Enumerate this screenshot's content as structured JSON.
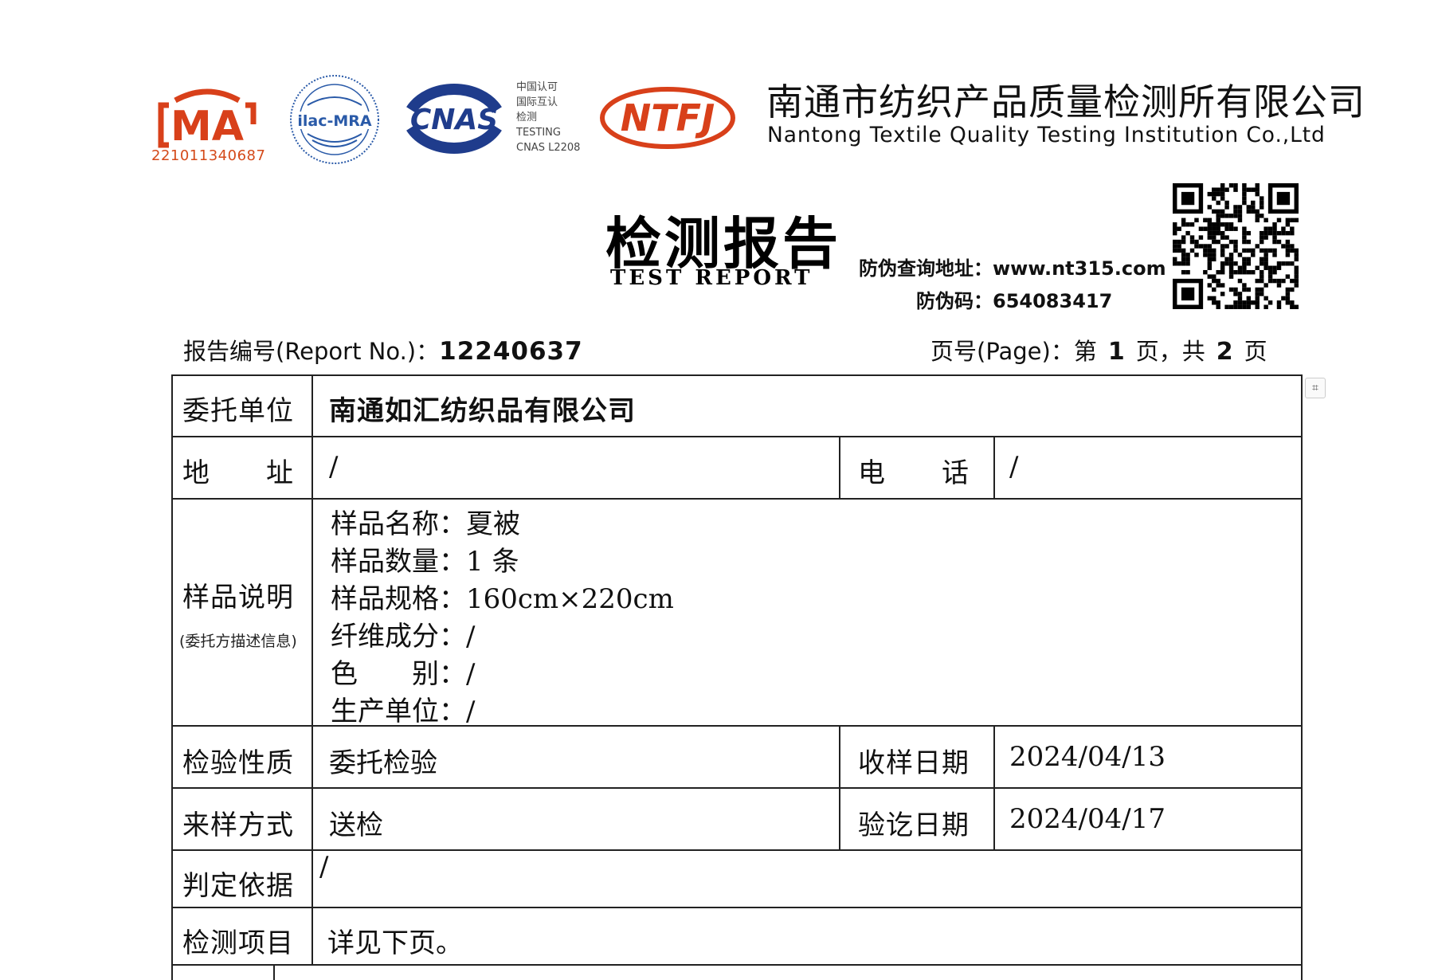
{
  "header": {
    "cma_number": "221011340687",
    "cma_logo_text": "MA",
    "ilac_logo_text": "ilac-MRA",
    "cnas_logo_text": "CNAS",
    "cnas_lines": [
      "中国认可",
      "国际互认",
      "检测",
      "TESTING",
      "CNAS L2208"
    ],
    "ntfj_logo_text": "NTFJ",
    "org_name_cn": "南通市纺织产品质量检测所有限公司",
    "org_name_en": "Nantong Textile Quality Testing Institution Co.,Ltd",
    "brand_color": "#d8401a",
    "cnas_color": "#1f3c8c"
  },
  "title": {
    "cn": "检测报告",
    "en": "TEST REPORT",
    "verify_url_label": "防伪查询地址：",
    "verify_url": "www.nt315.com",
    "verify_code_label": "防伪码：",
    "verify_code": "654083417"
  },
  "report": {
    "no_label": "报告编号(Report No.)：",
    "no_value": "12240637",
    "page_label": "页号(Page)：第",
    "page_current": "1",
    "page_mid": "页，共",
    "page_total": "2",
    "page_end": "页"
  },
  "table": {
    "client_label": "委托单位",
    "client_value": "南通如汇纺织品有限公司",
    "address_label": "地　　址",
    "address_value": "/",
    "phone_label": "电　　话",
    "phone_value": "/",
    "sample_label": "样品说明",
    "sample_sublabel": "(委托方描述信息)",
    "sample_lines": [
      "样品名称：夏被",
      "样品数量：1 条",
      "样品规格：160cm×220cm",
      "纤维成分：/",
      "色　　别：/",
      "生产单位：/"
    ],
    "nature_label": "检验性质",
    "nature_value": "委托检验",
    "receive_label": "收样日期",
    "receive_value": "2024/04/13",
    "method_label": "来样方式",
    "method_value": "送检",
    "finish_label": "验讫日期",
    "finish_value": "2024/04/17",
    "basis_label": "判定依据",
    "basis_value": "/",
    "items_label": "检测项目",
    "items_value": "详见下页。"
  }
}
